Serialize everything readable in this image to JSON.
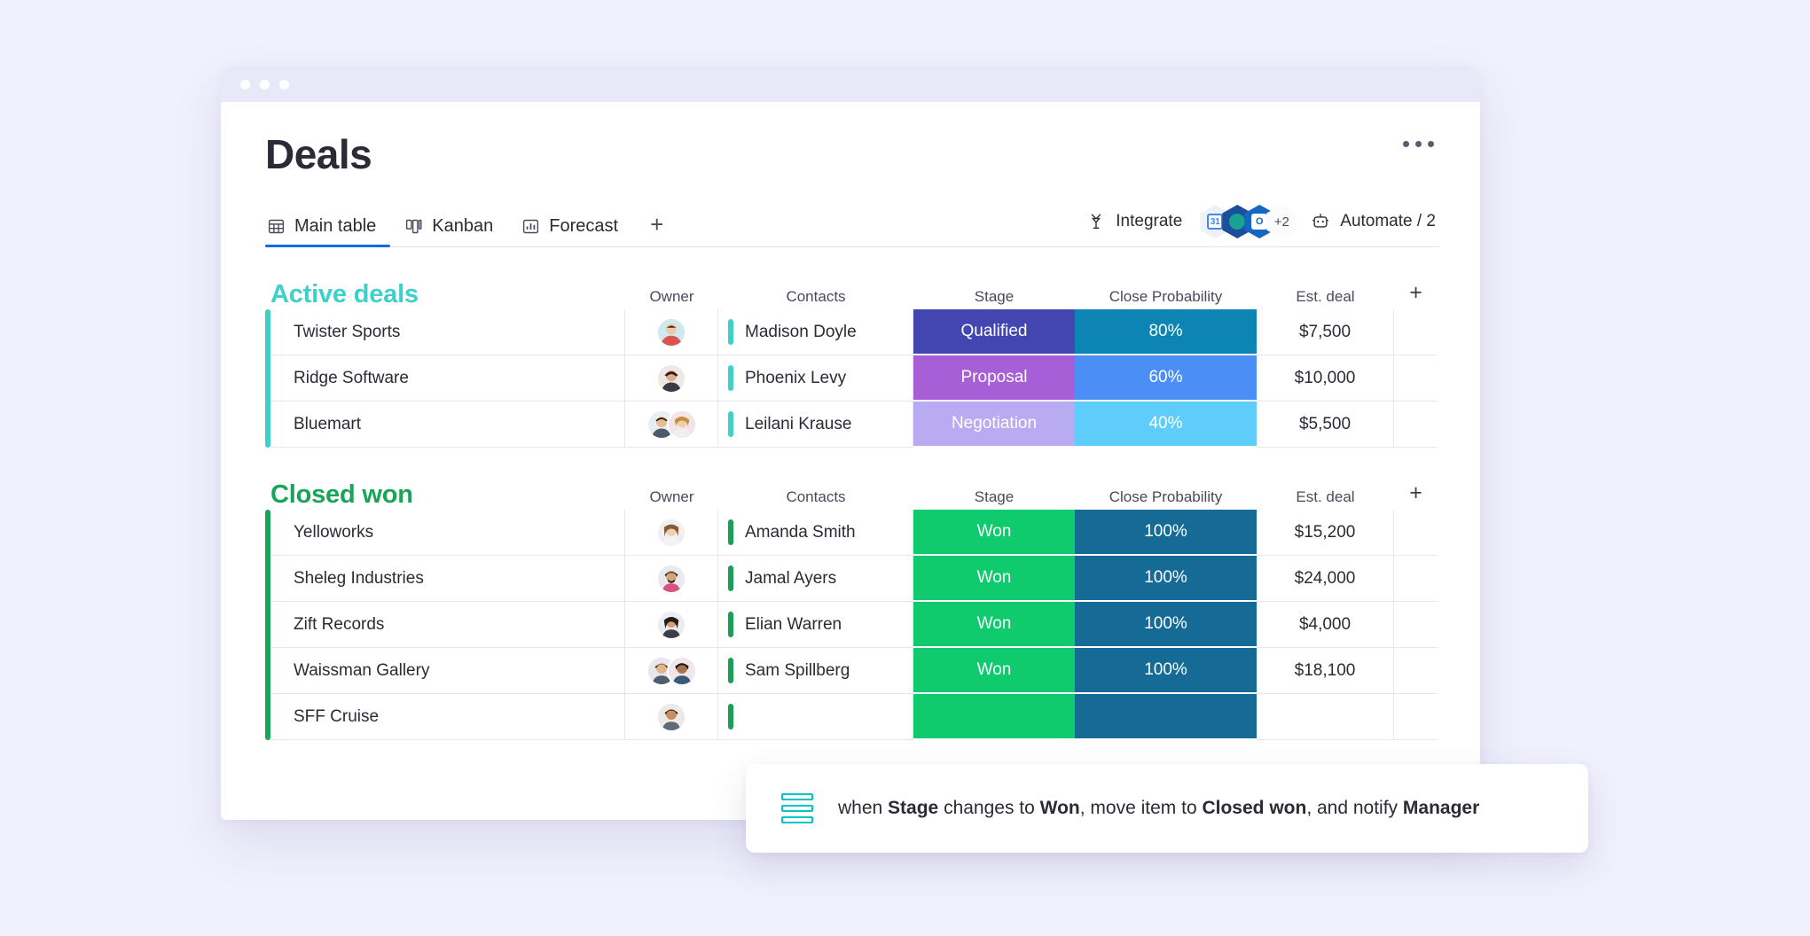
{
  "window": {
    "dots": [
      "close",
      "minimize",
      "maximize"
    ]
  },
  "header": {
    "title": "Deals",
    "kebab_label": "board-options"
  },
  "tabs": [
    {
      "label": "Main table",
      "icon": "table-icon",
      "active": true
    },
    {
      "label": "Kanban",
      "icon": "kanban-icon",
      "active": false
    },
    {
      "label": "Forecast",
      "icon": "chart-icon",
      "active": false
    }
  ],
  "add_tab_label": "+",
  "toolbar": {
    "integrate_label": "Integrate",
    "automate_label": "Automate / 2",
    "integration_overflow": "+2",
    "integration_apps": [
      "google-calendar",
      "microsoft-teams",
      "outlook"
    ]
  },
  "columns": [
    "Owner",
    "Contacts",
    "Stage",
    "Close Probability",
    "Est. deal"
  ],
  "add_column_label": "+",
  "groups": [
    {
      "title": "Active deals",
      "color": "#3fd0c9",
      "rows": [
        {
          "name": "Twister Sports",
          "owners": 1,
          "contact": "Madison Doyle",
          "stage": "Qualified",
          "stage_color": "#4346b0",
          "probability": "80%",
          "probability_color": "#0c84b4",
          "deal": "$7,500"
        },
        {
          "name": "Ridge Software",
          "owners": 1,
          "contact": "Phoenix Levy",
          "stage": "Proposal",
          "stage_color": "#a75fd8",
          "probability": "60%",
          "probability_color": "#4a8ef6",
          "deal": "$10,000"
        },
        {
          "name": "Bluemart",
          "owners": 2,
          "contact": "Leilani Krause",
          "stage": "Negotiation",
          "stage_color": "#b9abf2",
          "probability": "40%",
          "probability_color": "#5fcdfb",
          "deal": "$5,500"
        }
      ]
    },
    {
      "title": "Closed won",
      "color": "#18a558",
      "rows": [
        {
          "name": "Yelloworks",
          "owners": 1,
          "contact": "Amanda Smith",
          "stage": "Won",
          "stage_color": "#10ca6e",
          "probability": "100%",
          "probability_color": "#166a96",
          "deal": "$15,200"
        },
        {
          "name": "Sheleg Industries",
          "owners": 1,
          "contact": "Jamal Ayers",
          "stage": "Won",
          "stage_color": "#10ca6e",
          "probability": "100%",
          "probability_color": "#166a96",
          "deal": "$24,000"
        },
        {
          "name": "Zift Records",
          "owners": 1,
          "contact": "Elian Warren",
          "stage": "Won",
          "stage_color": "#10ca6e",
          "probability": "100%",
          "probability_color": "#166a96",
          "deal": "$4,000"
        },
        {
          "name": "Waissman Gallery",
          "owners": 2,
          "contact": "Sam Spillberg",
          "stage": "Won",
          "stage_color": "#10ca6e",
          "probability": "100%",
          "probability_color": "#166a96",
          "deal": "$18,100"
        },
        {
          "name": "SFF Cruise",
          "owners": 1,
          "contact": "",
          "stage": "",
          "stage_color": "#10ca6e",
          "probability": "",
          "probability_color": "#166a96",
          "deal": ""
        }
      ]
    }
  ],
  "automation": {
    "prefix": "when ",
    "trigger_field": "Stage",
    "mid1": " changes to ",
    "trigger_value": "Won",
    "mid2": ", move item to ",
    "target_group": "Closed won",
    "mid3": ", and notify ",
    "notify_role": "Manager",
    "icon": "automation-bars-icon",
    "accent": "#00c5c5"
  }
}
